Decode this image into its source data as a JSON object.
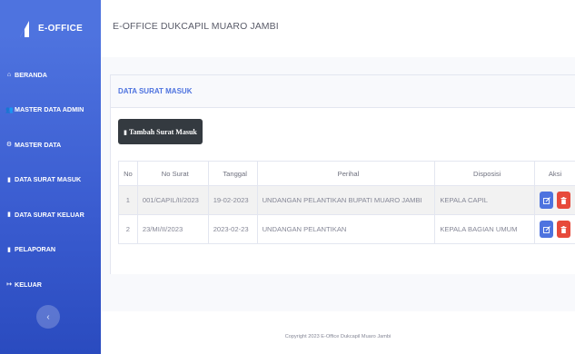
{
  "brand": {
    "title": "E-OFFICE"
  },
  "sidebar": {
    "items": [
      {
        "label": "BERANDA",
        "icon": "home-icon",
        "glyph": "⌂"
      },
      {
        "label": "MASTER DATA ADMIN",
        "icon": "users-icon",
        "glyph": "👥"
      },
      {
        "label": "MASTER DATA",
        "icon": "cog-icon",
        "glyph": "⚙"
      },
      {
        "label": "DATA SURAT MASUK",
        "icon": "file-icon",
        "glyph": "▮"
      },
      {
        "label": "DATA SURAT KELUAR",
        "icon": "file-icon",
        "glyph": "▮"
      },
      {
        "label": "PELAPORAN",
        "icon": "file-icon",
        "glyph": "▮"
      },
      {
        "label": "KELUAR",
        "icon": "sign-out-icon",
        "glyph": "↦"
      }
    ],
    "toggle_icon": "chevron-left-icon",
    "toggle_glyph": "‹"
  },
  "topbar": {
    "title": "E-OFFICE DUKCAPIL MUARO JAMBI"
  },
  "card": {
    "title": "DATA SURAT MASUK",
    "add_button": "Tambah Surat Masuk",
    "add_icon": "file-icon"
  },
  "table": {
    "headers": [
      "No",
      "No Surat",
      "Tanggal",
      "Perihal",
      "Disposisi",
      "Aksi"
    ],
    "rows": [
      {
        "no": "1",
        "no_surat": "001/CAPIL/II/2023",
        "tanggal": "19-02-2023",
        "perihal": "UNDANGAN PELANTIKAN BUPATI MUARO JAMBI",
        "disposisi": "KEPALA CAPIL"
      },
      {
        "no": "2",
        "no_surat": "23/MI/II/2023",
        "tanggal": "2023-02-23",
        "perihal": "UNDANGAN PELANTIKAN",
        "disposisi": "KEPALA BAGIAN UMUM"
      }
    ],
    "edit_icon": "edit-icon",
    "delete_icon": "trash-icon"
  },
  "footer": {
    "text": "Copyright 2023 E-Office Dukcapil Muaro Jambi"
  },
  "colors": {
    "primary": "#4e73df",
    "danger": "#e74a3b",
    "dark": "#343a40"
  }
}
